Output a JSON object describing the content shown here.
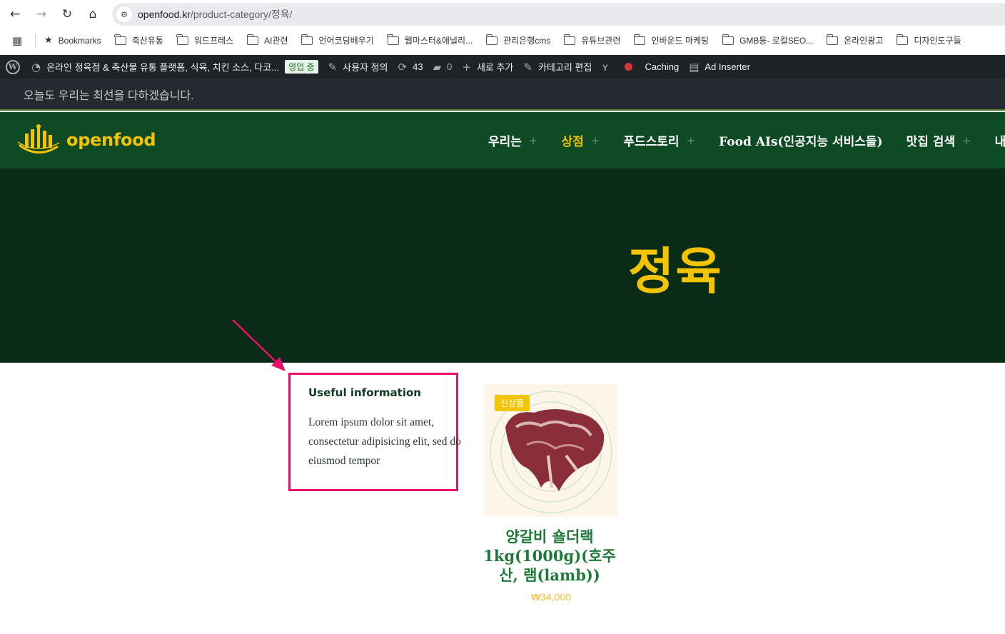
{
  "browser": {
    "url_host": "openfood.kr",
    "url_path": "/product-category/정육/",
    "back": "←",
    "forward": "→",
    "reload": "↻",
    "home": "⌂",
    "site_info": "⚙"
  },
  "bookmarks": {
    "apps": "▦",
    "items": [
      {
        "label": "Bookmarks",
        "icon": "star-icon"
      },
      {
        "label": "축산유통",
        "icon": "folder-icon"
      },
      {
        "label": "워드프레스",
        "icon": "folder-icon"
      },
      {
        "label": "AI관련",
        "icon": "folder-icon"
      },
      {
        "label": "언어코딩배우기",
        "icon": "folder-icon"
      },
      {
        "label": "웹마스터&애널리...",
        "icon": "folder-icon"
      },
      {
        "label": "관리은행cms",
        "icon": "folder-icon"
      },
      {
        "label": "유튜브관련",
        "icon": "folder-icon"
      },
      {
        "label": "인바운드 마케팅",
        "icon": "folder-icon"
      },
      {
        "label": "GMB등- 로컬SEO...",
        "icon": "folder-icon"
      },
      {
        "label": "온라인광고",
        "icon": "folder-icon"
      },
      {
        "label": "디자인도구들",
        "icon": "folder-icon"
      }
    ]
  },
  "admin_bar": {
    "site_name": "온라인 정육점 & 축산물 유통 플랫폼, 식육, 치킨 소스, 다코...",
    "live_badge": "영업 중",
    "customize": "사용자 정의",
    "updates_count": "43",
    "comments_count": "0",
    "new": "새로 추가",
    "edit_category": "카테고리 편집",
    "caching": "Caching",
    "ad_inserter": "Ad Inserter"
  },
  "topbar": {
    "tagline": "오늘도 우리는 최선을 다하겠습니다."
  },
  "header": {
    "logo_text": "openfood",
    "menu": [
      {
        "label": "우리는",
        "plus": true,
        "active": false
      },
      {
        "label": "상점",
        "plus": true,
        "active": true
      },
      {
        "label": "푸드스토리",
        "plus": true,
        "active": false
      },
      {
        "label": "Food AIs(인공지능 서비스들)",
        "plus": false,
        "active": false
      },
      {
        "label": "맛집 검색",
        "plus": true,
        "active": false
      },
      {
        "label": "내",
        "plus": false,
        "active": false
      }
    ]
  },
  "hero": {
    "title": "정육"
  },
  "info_box": {
    "title": "Useful information",
    "body": "Lorem ipsum dolor sit amet, consectetur adipisicing elit, sed do eiusmod tempor"
  },
  "product": {
    "badge": "신상품",
    "name": "양갈비 숄더랙 1kg(1000g)(호주산, 램(lamb))",
    "price": "₩34,000"
  },
  "colors": {
    "header_green": "#0e4a24",
    "hero_green": "#0a2c16",
    "accent_yellow": "#f5c400",
    "highlight_pink": "#e8106a",
    "product_green": "#1f7a3a"
  }
}
